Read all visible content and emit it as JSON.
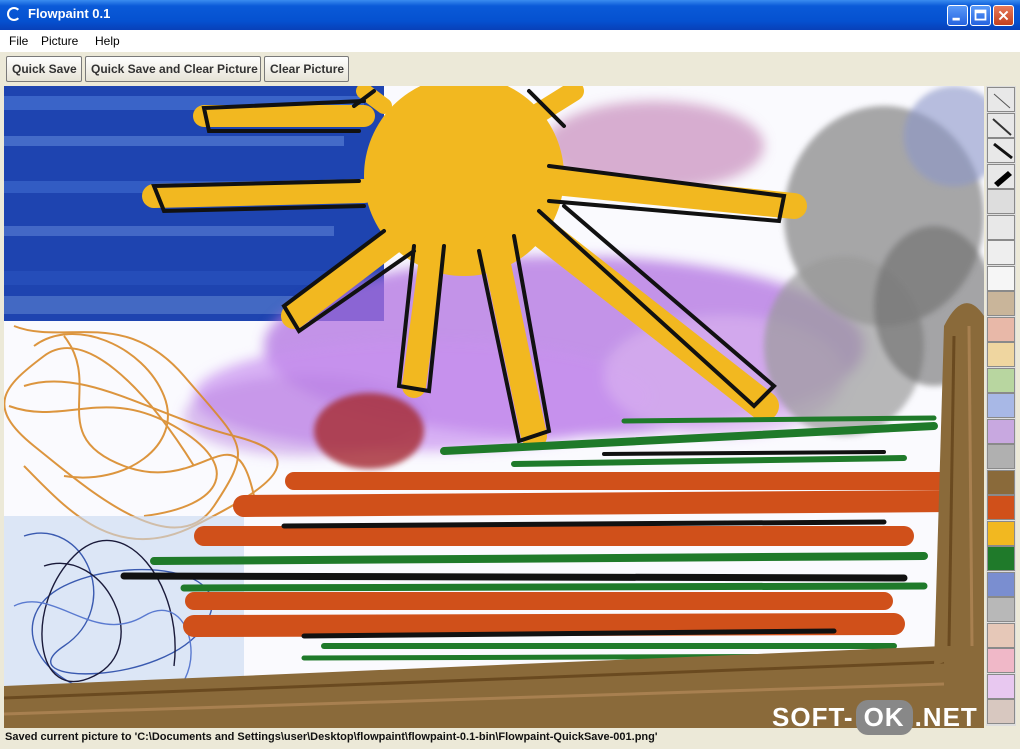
{
  "window": {
    "title": "Flowpaint 0.1"
  },
  "menu": {
    "items": [
      "File",
      "Picture",
      "Help"
    ]
  },
  "toolbar": {
    "buttons": [
      "Quick Save",
      "Quick Save and Clear Picture",
      "Clear Picture"
    ]
  },
  "status": {
    "message": "Saved current picture to 'C:\\Documents and Settings\\user\\Desktop\\flowpaint\\flowpaint-0.1-bin\\Flowpaint-QuickSave-001.png'"
  },
  "watermark": {
    "left": "SOFT-",
    "pill": "OK",
    "right": ".NET"
  },
  "palette": [
    {
      "kind": "brush",
      "icon": "thin-pen-icon",
      "color": "#555555"
    },
    {
      "kind": "brush",
      "icon": "pen-icon",
      "color": "#333333"
    },
    {
      "kind": "brush",
      "icon": "marker-icon",
      "color": "#111111"
    },
    {
      "kind": "brush",
      "icon": "wide-brush-icon",
      "color": "#000000"
    },
    {
      "kind": "color",
      "color": "#dddddd"
    },
    {
      "kind": "color",
      "color": "#e8e8e8"
    },
    {
      "kind": "color",
      "color": "#eeeeee"
    },
    {
      "kind": "color",
      "color": "#f6f6f6"
    },
    {
      "kind": "color",
      "color": "#c9b59a"
    },
    {
      "kind": "color",
      "color": "#e8b8a8"
    },
    {
      "kind": "color",
      "color": "#efd6a0"
    },
    {
      "kind": "color",
      "color": "#b8d6a0"
    },
    {
      "kind": "color",
      "color": "#a8b8e6"
    },
    {
      "kind": "color",
      "color": "#c8a8e0"
    },
    {
      "kind": "color",
      "color": "#b0b0b0"
    },
    {
      "kind": "color",
      "color": "#8a6a3a"
    },
    {
      "kind": "color",
      "color": "#d0501a"
    },
    {
      "kind": "color",
      "color": "#f2b820"
    },
    {
      "kind": "color",
      "color": "#1f7a2a"
    },
    {
      "kind": "color",
      "color": "#7a8ed0"
    },
    {
      "kind": "color",
      "color": "#b8b8b8"
    },
    {
      "kind": "color",
      "color": "#e6c8b8"
    },
    {
      "kind": "color",
      "color": "#f0b8c8"
    },
    {
      "kind": "color",
      "color": "#e8c8f0"
    },
    {
      "kind": "color",
      "color": "#d8c8c0"
    }
  ]
}
